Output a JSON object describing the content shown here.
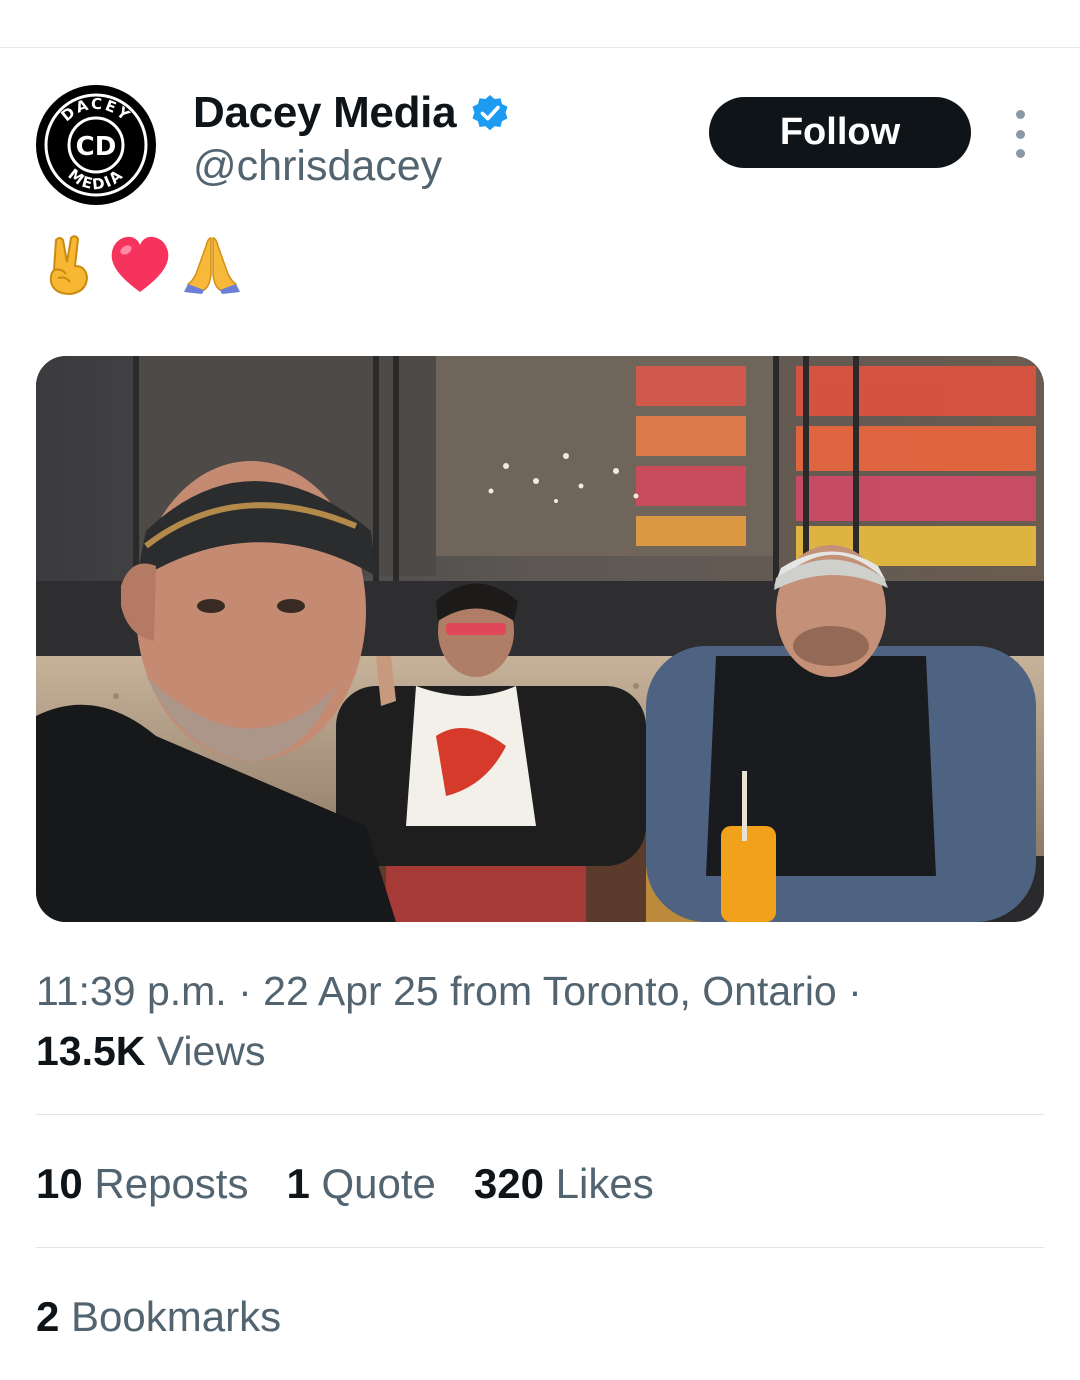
{
  "author": {
    "name": "Dacey Media",
    "handle": "@chrisdacey",
    "verified": true,
    "avatar_text_top": "DACEY",
    "avatar_text_bottom": "MEDIA"
  },
  "actions": {
    "follow_label": "Follow"
  },
  "post": {
    "emojis": [
      "victory-hand-emoji",
      "red-heart-emoji",
      "folded-hands-emoji"
    ],
    "photo_description_icon": "restaurant-selfie-photo"
  },
  "meta": {
    "time": "11:39 p.m.",
    "separator": "·",
    "date": "22 Apr 25",
    "location_text": "from Toronto, Ontario",
    "views_count": "13.5K",
    "views_label": "Views"
  },
  "stats": {
    "reposts_count": "10",
    "reposts_label": "Reposts",
    "quotes_count": "1",
    "quotes_label": "Quote",
    "likes_count": "320",
    "likes_label": "Likes",
    "bookmarks_count": "2",
    "bookmarks_label": "Bookmarks"
  },
  "colors": {
    "primary_text": "#0f1419",
    "secondary_text": "#536471",
    "verified_blue": "#1d9bf0",
    "follow_bg": "#0f1419"
  }
}
